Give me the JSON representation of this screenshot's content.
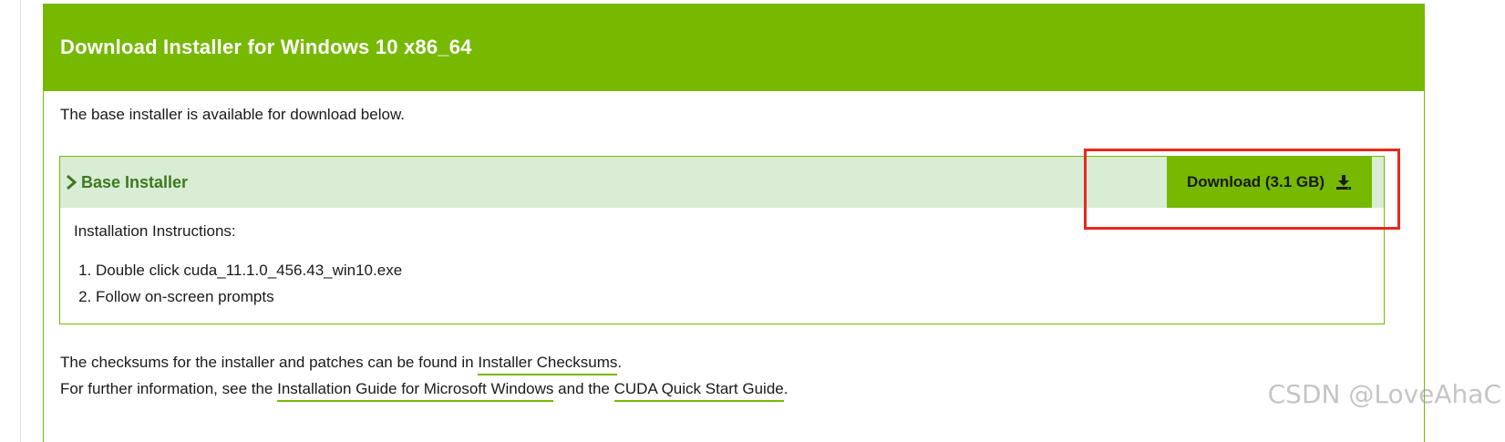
{
  "panel": {
    "title": "Download Installer for Windows 10 x86_64",
    "intro": "The base installer is available for download below."
  },
  "installer": {
    "label": "Base Installer",
    "download_label": "Download (3.1 GB)",
    "instructions_heading": "Installation Instructions:",
    "steps": [
      "Double click cuda_11.1.0_456.43_win10.exe",
      "Follow on-screen prompts"
    ]
  },
  "footer": {
    "line1_prefix": "The checksums for the installer and patches can be found in",
    "line1_link": "Installer Checksums",
    "line1_suffix": ".",
    "line2_prefix": "For further information, see the",
    "line2_link1": "Installation Guide for Microsoft Windows",
    "line2_middle": "and the",
    "line2_link2": "CUDA Quick Start Guide",
    "line2_suffix": "."
  },
  "watermark": "CSDN @LoveAhaC",
  "colors": {
    "accent": "#76b900",
    "bar_background": "#d9ecd4",
    "installer_label": "#3b7a1e",
    "highlight": "#e8281e"
  },
  "icons": {
    "expand": "chevron-right-icon",
    "download": "download-icon"
  }
}
